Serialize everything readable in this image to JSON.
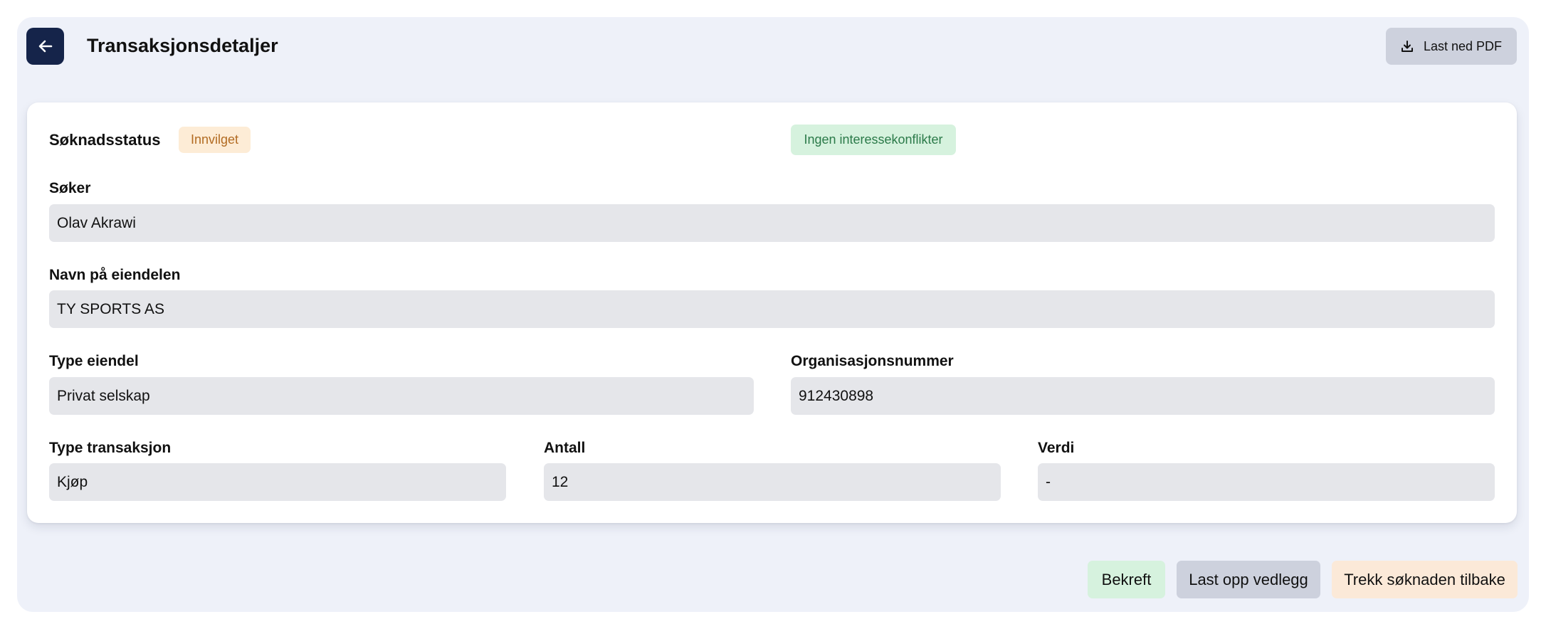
{
  "header": {
    "title": "Transaksjonsdetaljer",
    "pdf_button_label": "Last ned PDF"
  },
  "status": {
    "label": "Søknadsstatus",
    "badge": "Innvilget",
    "conflict_badge": "Ingen interessekonflikter"
  },
  "fields": {
    "applicant": {
      "label": "Søker",
      "value": "Olav Akrawi"
    },
    "asset_name": {
      "label": "Navn på eiendelen",
      "value": "TY SPORTS AS"
    },
    "asset_type": {
      "label": "Type eiendel",
      "value": "Privat selskap"
    },
    "org_number": {
      "label": "Organisasjonsnummer",
      "value": "912430898"
    },
    "transaction_type": {
      "label": "Type transaksjon",
      "value": "Kjøp"
    },
    "quantity": {
      "label": "Antall",
      "value": "12"
    },
    "value": {
      "label": "Verdi",
      "value": "-"
    }
  },
  "actions": {
    "confirm": "Bekreft",
    "upload": "Last opp vedlegg",
    "withdraw": "Trekk søknaden tilbake"
  },
  "icons": {
    "back": "arrow-left-icon",
    "download": "download-icon"
  },
  "colors": {
    "back_button": "#15244a",
    "panel_background": "#eef1f9",
    "approved_badge_bg": "#fdecd6",
    "approved_badge_text": "#b26b22",
    "conflict_badge_bg": "#d6f2de",
    "conflict_badge_text": "#2b7a49",
    "field_background": "#e5e6ea",
    "confirm_button": "#d6f2de",
    "upload_button": "#cdd1dd",
    "withdraw_button": "#fbe9d8"
  }
}
